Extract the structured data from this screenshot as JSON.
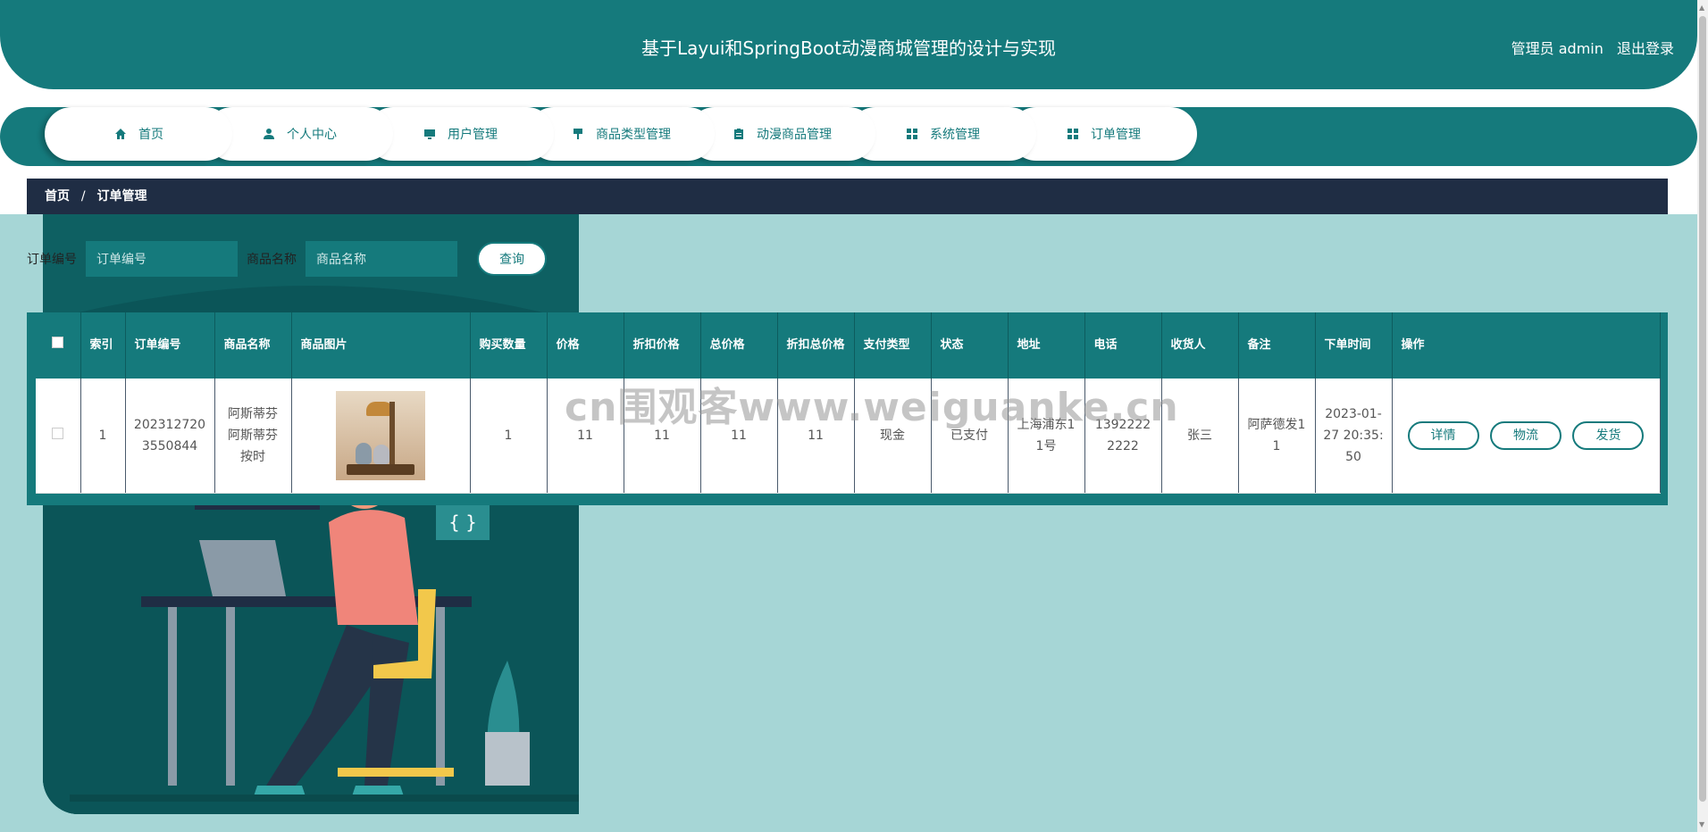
{
  "header": {
    "title": "基于Layui和SpringBoot动漫商城管理的设计与实现",
    "user_label": "管理员 admin",
    "logout_label": "退出登录"
  },
  "nav": {
    "items": [
      {
        "label": "首页",
        "icon": "home-icon"
      },
      {
        "label": "个人中心",
        "icon": "user-icon"
      },
      {
        "label": "用户管理",
        "icon": "monitor-icon"
      },
      {
        "label": "商品类型管理",
        "icon": "brush-icon"
      },
      {
        "label": "动漫商品管理",
        "icon": "clipboard-icon"
      },
      {
        "label": "系统管理",
        "icon": "grid-icon"
      },
      {
        "label": "订单管理",
        "icon": "grid-icon"
      }
    ]
  },
  "breadcrumb": {
    "home": "首页",
    "separator": "/",
    "current": "订单管理"
  },
  "search": {
    "order_no_label": "订单编号",
    "order_no_placeholder": "订单编号",
    "product_name_label": "商品名称",
    "product_name_placeholder": "商品名称",
    "query_label": "查询"
  },
  "table": {
    "columns": [
      "索引",
      "订单编号",
      "商品名称",
      "商品图片",
      "购买数量",
      "价格",
      "折扣价格",
      "总价格",
      "折扣总价格",
      "支付类型",
      "状态",
      "地址",
      "电话",
      "收货人",
      "备注",
      "下单时间",
      "操作"
    ],
    "rows": [
      {
        "index": "1",
        "order_no": "2023127203550844",
        "product_name": "阿斯蒂芬阿斯蒂芬按时",
        "image_text": "图片",
        "quantity": "1",
        "price": "11",
        "discount_price": "11",
        "total_price": "11",
        "discount_total": "11",
        "pay_type": "现金",
        "status": "已支付",
        "address": "上海浦东11号",
        "phone": "13922222222",
        "receiver": "张三",
        "remark": "阿萨德发11",
        "order_time": "2023-01-27 20:35:50",
        "actions": [
          "详情",
          "物流",
          "发货"
        ]
      }
    ]
  },
  "watermark": "cn围观客www.weiguanke.cn",
  "colors": {
    "primary": "#157a7c",
    "breadcrumb_bg": "#1f2d44",
    "page_bg": "#a6d6d6"
  }
}
